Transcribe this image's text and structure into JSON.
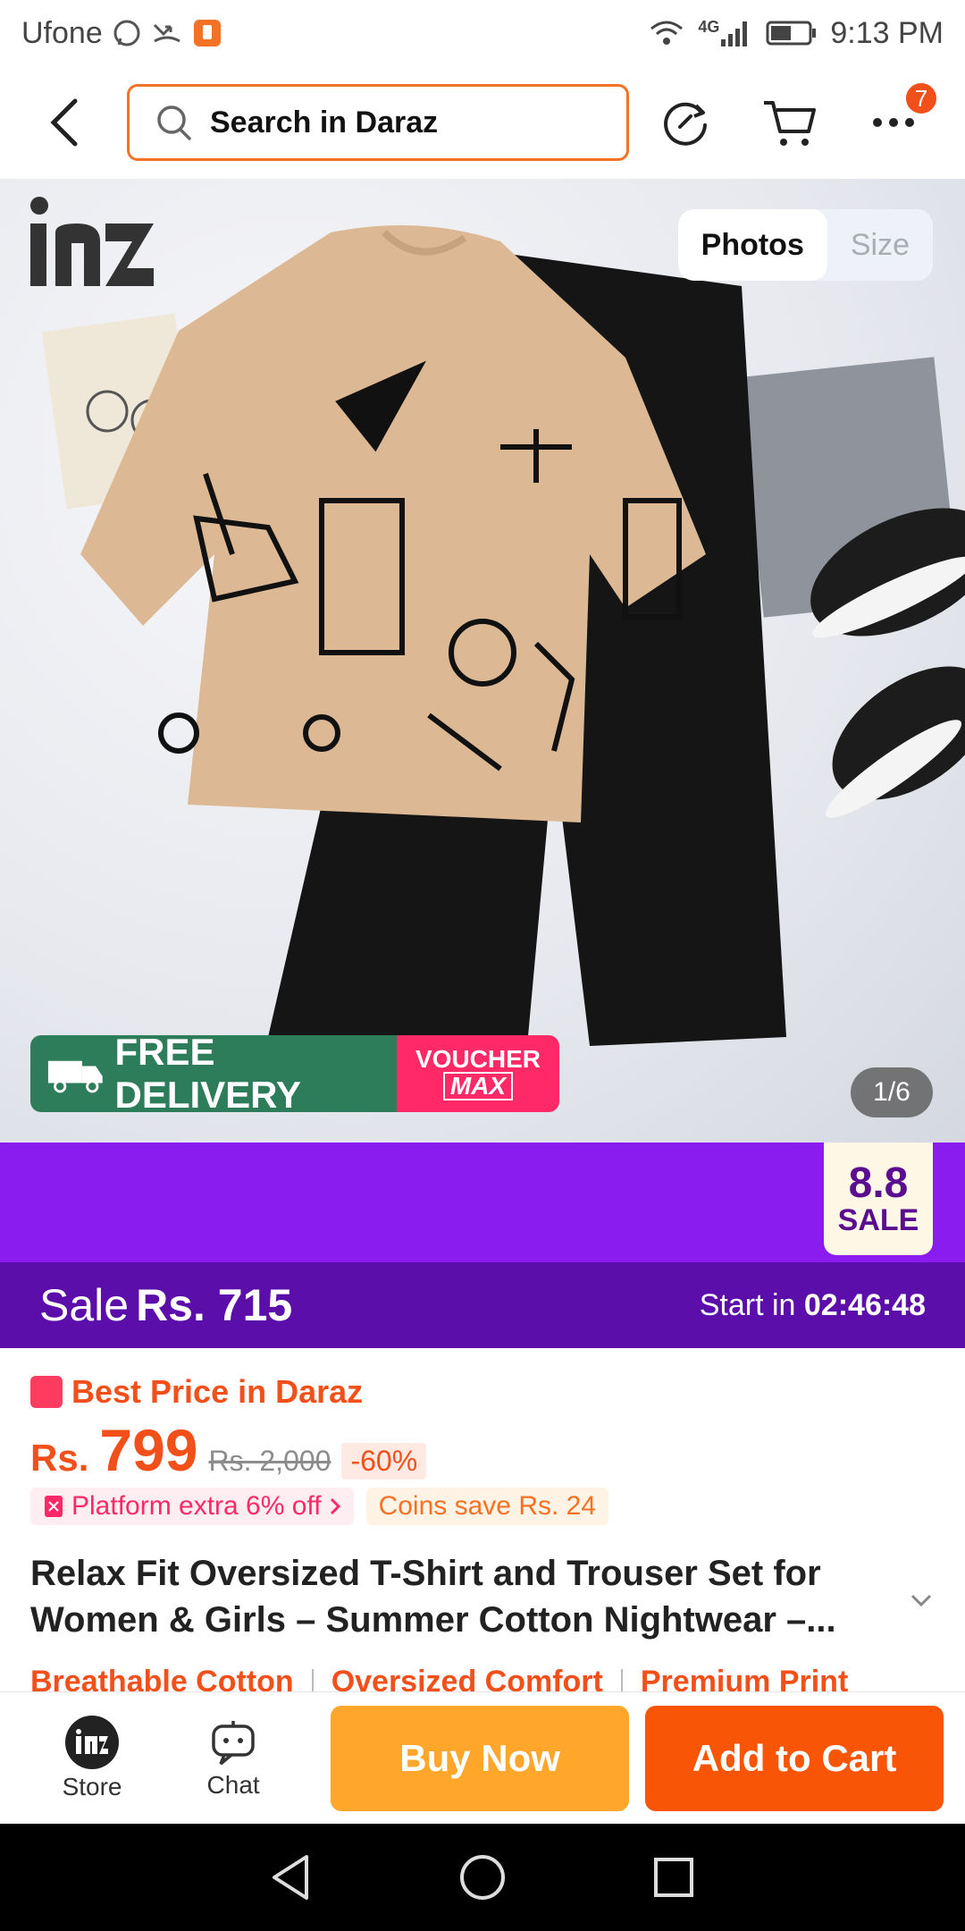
{
  "status": {
    "carrier": "Ufone",
    "network": "4G",
    "time": "9:13 PM"
  },
  "header": {
    "search_placeholder": "Search in Daraz",
    "cart_badge": "7"
  },
  "gallery": {
    "tabs": [
      "Photos",
      "Size"
    ],
    "active_tab": "Photos",
    "counter": "1/6",
    "promo_free": "FREE DELIVERY",
    "promo_voucher_1": "VOUCHER",
    "promo_voucher_2": "MAX",
    "brand": "nz"
  },
  "sale": {
    "tag_number": "8.8",
    "tag_label": "SALE",
    "label": "Sale",
    "price": "Rs. 715",
    "start_label": "Start in",
    "countdown": "02:46:48"
  },
  "price": {
    "best_label": "Best Price in Daraz",
    "currency": "Rs.",
    "amount": "799",
    "original": "Rs. 2,000",
    "discount": "-60%",
    "chip_platform": "Platform extra 6% off",
    "chip_coins": "Coins save Rs. 24"
  },
  "product": {
    "title": "Relax Fit Oversized T-Shirt and Trouser Set for Women & Girls – Summer Cotton Nightwear –...",
    "features": [
      "Breathable Cotton",
      "Oversized Comfort",
      "Premium Print"
    ]
  },
  "actions": {
    "store": "Store",
    "chat": "Chat",
    "buy_now": "Buy Now",
    "add_to_cart": "Add to Cart"
  },
  "colors": {
    "accent": "#f57224",
    "sale_purple": "#8a1cf0",
    "sale_dark": "#5b0eaa",
    "buy": "#ffa62b",
    "cart": "#f85606"
  }
}
